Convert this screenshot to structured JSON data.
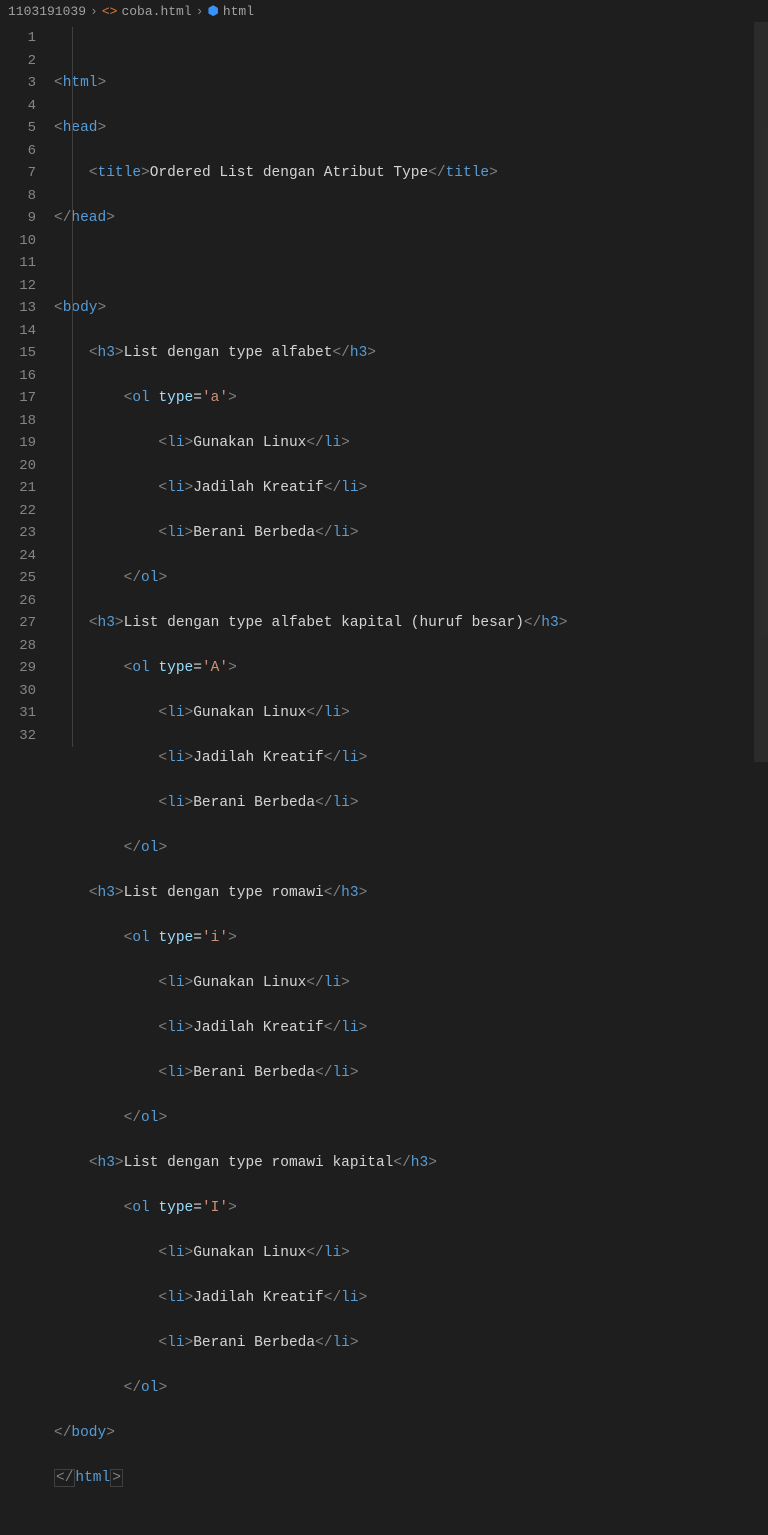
{
  "breadcrumbs": {
    "folder": "1103191039",
    "file": "coba.html",
    "symbol": "html"
  },
  "code": {
    "title_text": "Ordered List dengan Atribut Type",
    "h3_1": "List dengan type alfabet",
    "type_a": "'a'",
    "h3_2": "List dengan type alfabet kapital (huruf besar)",
    "type_A": "'A'",
    "h3_3": "List dengan type romawi",
    "type_i": "'i'",
    "h3_4": "List dengan type romawi kapital",
    "type_I": "'I'",
    "li_1": "Gunakan Linux",
    "li_2": "Jadilah Kreatif",
    "li_3": "Berani Berbeda"
  },
  "line_numbers": [
    "1",
    "2",
    "3",
    "4",
    "5",
    "6",
    "7",
    "8",
    "9",
    "10",
    "11",
    "12",
    "13",
    "14",
    "15",
    "16",
    "17",
    "18",
    "19",
    "20",
    "21",
    "22",
    "23",
    "24",
    "25",
    "26",
    "27",
    "28",
    "29",
    "30",
    "31",
    "32"
  ]
}
